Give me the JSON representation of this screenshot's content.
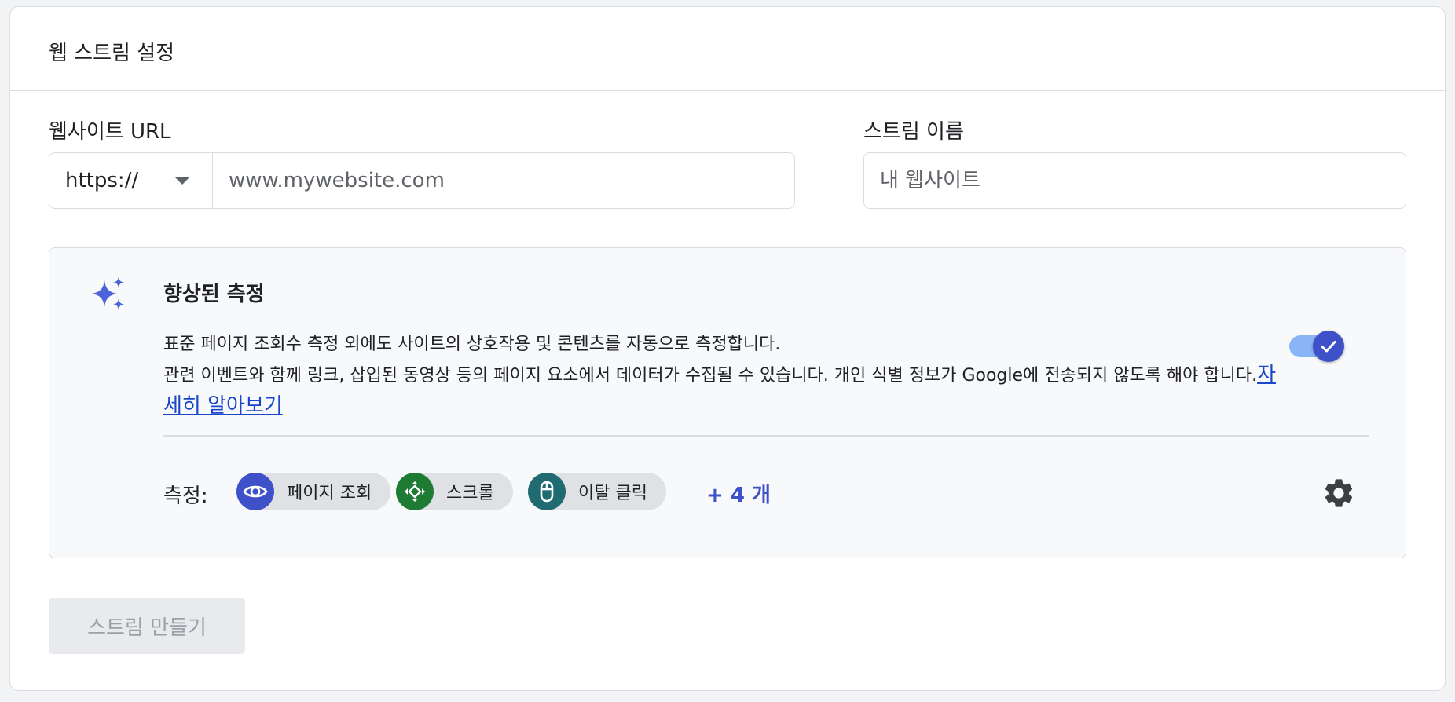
{
  "header": {
    "title": "웹 스트림 설정"
  },
  "url_field": {
    "label": "웹사이트 URL",
    "protocol": "https://",
    "placeholder": "www.mywebsite.com"
  },
  "name_field": {
    "label": "스트림 이름",
    "placeholder": "내 웹사이트"
  },
  "enhanced_measurement": {
    "title": "향상된 측정",
    "description_line1": "표준 페이지 조회수 측정 외에도 사이트의 상호작용 및 콘텐츠를 자동으로 측정합니다.",
    "description_line2": "관련 이벤트와 함께 링크, 삽입된 동영상 등의 페이지 요소에서 데이터가 수집될 수 있습니다. 개인 식별 정보가 Google에 전송되지 않도록 해야 합니다.",
    "learn_more": "자세히 알아보기",
    "toggle_on": true,
    "measuring_label": "측정:",
    "chips": [
      {
        "label": "페이지 조회",
        "icon": "eye-icon",
        "color": "#3f51c8"
      },
      {
        "label": "스크롤",
        "icon": "scroll-arrows-icon",
        "color": "#1e7b34"
      },
      {
        "label": "이탈 클릭",
        "icon": "mouse-icon",
        "color": "#206b72"
      }
    ],
    "more": "+ 4 개"
  },
  "actions": {
    "create_button": "스트림 만들기"
  },
  "colors": {
    "accent": "#3f51c8",
    "link": "#1a46c9",
    "toggle_track": "#8ab4f8",
    "disabled_bg": "#e8eaed",
    "disabled_text": "#9aa0a6"
  }
}
